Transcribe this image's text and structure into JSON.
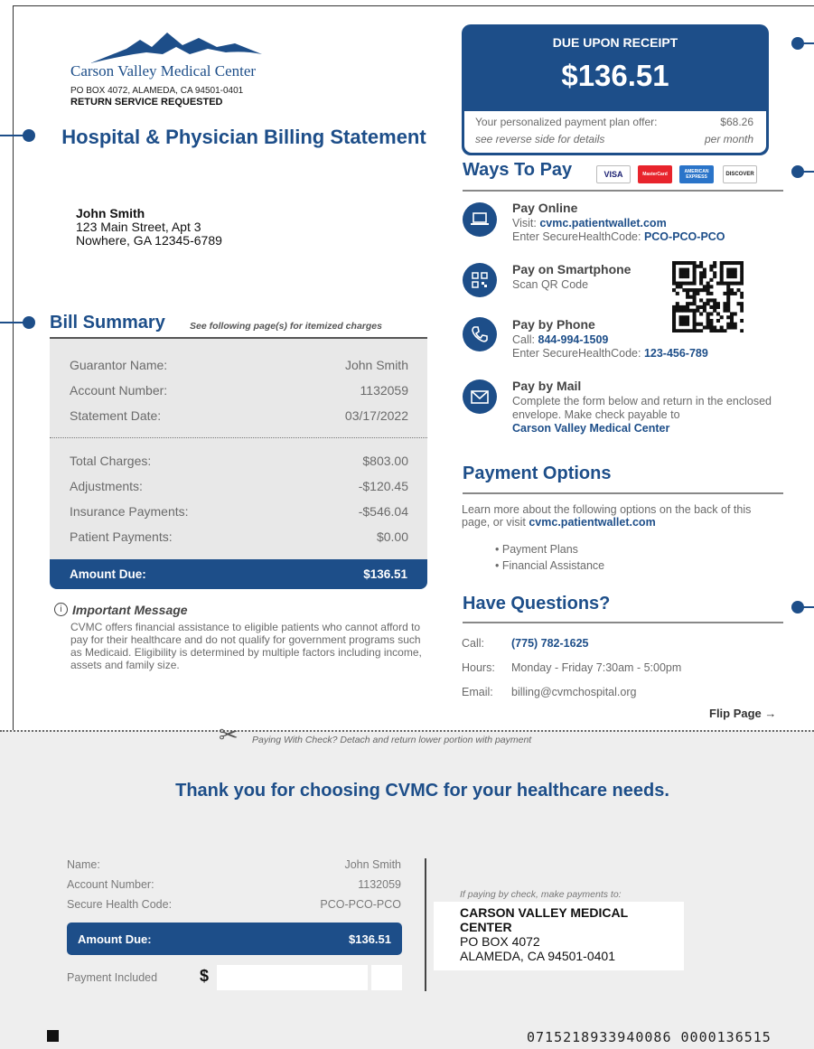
{
  "colors": {
    "brand": "#1d4e89",
    "stub_bg": "#eeeeee",
    "summary_bg": "#e8e8e8"
  },
  "header": {
    "logo_name": "Carson Valley Medical Center",
    "return_address": "PO BOX 4072, ALAMEDA, CA 94501-0401",
    "return_service": "RETURN SERVICE REQUESTED",
    "title": "Hospital & Physician Billing Statement"
  },
  "recipient": {
    "name": "John Smith",
    "line1": "123 Main Street, Apt 3",
    "line2": "Nowhere, GA 12345-6789"
  },
  "due": {
    "label": "DUE UPON RECEIPT",
    "amount": "$136.51",
    "plan_text": "Your personalized payment plan offer:",
    "plan_amount": "$68.26",
    "plan_note": "see reverse side for details",
    "plan_period": "per month"
  },
  "summary": {
    "title": "Bill Summary",
    "note": "See following page(s) for itemized charges",
    "rows_top": [
      {
        "label": "Guarantor Name:",
        "value": "John Smith"
      },
      {
        "label": "Account Number:",
        "value": "1132059"
      },
      {
        "label": "Statement Date:",
        "value": "03/17/2022"
      }
    ],
    "rows_bottom": [
      {
        "label": "Total Charges:",
        "value": "$803.00"
      },
      {
        "label": "Adjustments:",
        "value": "-$120.45"
      },
      {
        "label": "Insurance Payments:",
        "value": "-$546.04"
      },
      {
        "label": "Patient Payments:",
        "value": "$0.00"
      }
    ],
    "amount_due_label": "Amount Due:",
    "amount_due_value": "$136.51"
  },
  "message": {
    "title": "Important Message",
    "body": "CVMC offers financial assistance to eligible patients who cannot afford to pay for their healthcare and do not qualify for government programs such as Medicaid. Eligibility is determined by multiple factors including income, assets and family size."
  },
  "ways": {
    "title": "Ways To Pay",
    "cards": [
      "VISA",
      "MasterCard",
      "AMERICAN EXPRESS",
      "DISCOVER"
    ],
    "online": {
      "title": "Pay Online",
      "visit_label": "Visit:",
      "url": "cvmc.patientwallet.com",
      "code_label": "Enter SecureHealthCode:",
      "code": "PCO-PCO-PCO",
      "icon": "laptop-icon"
    },
    "smartphone": {
      "title": "Pay on Smartphone",
      "text": "Scan QR Code",
      "icon": "qr-icon"
    },
    "phone": {
      "title": "Pay by Phone",
      "call_label": "Call:",
      "number": "844-994-1509",
      "code_label": "Enter SecureHealthCode:",
      "code": "123-456-789",
      "icon": "phone-icon"
    },
    "mail": {
      "title": "Pay by Mail",
      "text": "Complete the form below and return in the enclosed envelope. Make check payable to",
      "payee": "Carson Valley Medical Center",
      "icon": "envelope-icon"
    }
  },
  "options": {
    "title": "Payment Options",
    "intro": "Learn more about the following options on the back of this page, or visit",
    "url": "cvmc.patientwallet.com",
    "items": [
      "Payment Plans",
      "Financial Assistance"
    ]
  },
  "questions": {
    "title": "Have Questions?",
    "call_label": "Call:",
    "call": "(775) 782-1625",
    "hours_label": "Hours:",
    "hours": "Monday - Friday 7:30am - 5:00pm",
    "email_label": "Email:",
    "email": "billing@cvmchospital.org"
  },
  "flip": "Flip Page",
  "detach": "Paying With Check? Detach and return lower portion with payment",
  "stub": {
    "thanks": "Thank you for choosing CVMC for your healthcare needs.",
    "rows": [
      {
        "label": "Name:",
        "value": "John Smith"
      },
      {
        "label": "Account Number:",
        "value": "1132059"
      },
      {
        "label": "Secure Health Code:",
        "value": "PCO-PCO-PCO"
      }
    ],
    "amount_due_label": "Amount Due:",
    "amount_due_value": "$136.51",
    "payment_included": "Payment Included",
    "dollar": "$",
    "check_note": "If paying by check, make payments to:",
    "payee_line1": "CARSON VALLEY MEDICAL",
    "payee_line2": "CENTER",
    "payee_line3": "PO BOX 4072",
    "payee_line4": "ALAMEDA, CA 94501-0401",
    "scanline": "0715218933940086 0000136515"
  }
}
